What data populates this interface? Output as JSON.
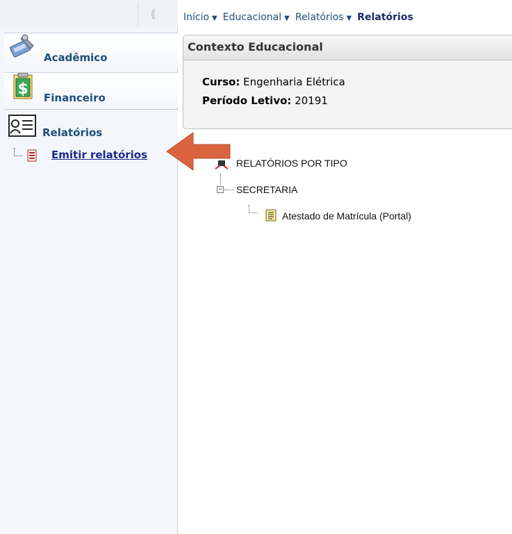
{
  "sidebar": {
    "collapse_label": "⟨⟨",
    "tabs": [
      {
        "label": "Acadêmico",
        "icon": "wrench-book-icon"
      },
      {
        "label": "Financeiro",
        "icon": "dollar-document-icon"
      },
      {
        "label": "Relatórios",
        "icon": "report-card-icon"
      }
    ],
    "submenu": [
      {
        "label": "Emitir relatórios",
        "icon": "document-icon"
      }
    ]
  },
  "breadcrumb": [
    {
      "label": "Início"
    },
    {
      "label": "Educacional"
    },
    {
      "label": "Relatórios"
    },
    {
      "label": "Relatórios"
    }
  ],
  "context": {
    "title": "Contexto Educacional",
    "curso_label": "Curso:",
    "curso_value": "Engenharia Elétrica",
    "periodo_label": "Período Letivo:",
    "periodo_value": "20191"
  },
  "tree": {
    "root_label": "RELATÓRIOS POR TIPO",
    "group_label": "SECRETARIA",
    "group_toggle": "−",
    "leaf_label": "Atestado de Matrícula (Portal)"
  },
  "colors": {
    "sidebar_text": "#1d4f7a",
    "link": "#1a2a8a",
    "arrow": "#d9643f"
  }
}
